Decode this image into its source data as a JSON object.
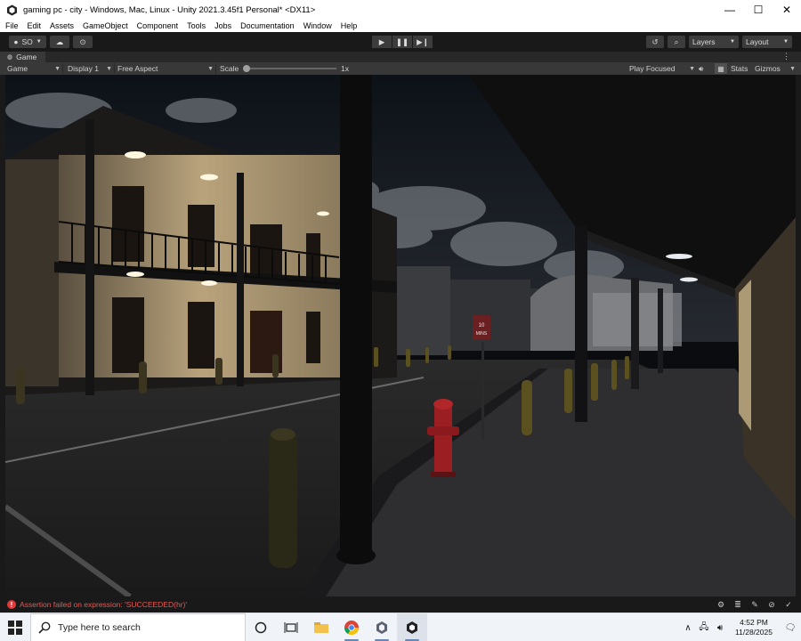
{
  "window": {
    "title": "gaming pc - city - Windows, Mac, Linux - Unity 2021.3.45f1 Personal* <DX11>",
    "controls": [
      "—",
      "☐",
      "✕"
    ]
  },
  "menu": [
    "File",
    "Edit",
    "Assets",
    "GameObject",
    "Component",
    "Tools",
    "Jobs",
    "Documentation",
    "Window",
    "Help"
  ],
  "toolbar": {
    "account_label": "SO",
    "layers_label": "Layers",
    "layout_label": "Layout"
  },
  "game_tab": {
    "label": "Game"
  },
  "game_controls": {
    "mode": "Game",
    "display": "Display 1",
    "aspect": "Free Aspect",
    "scale_label": "Scale",
    "scale_value": "1x",
    "play_mode": "Play Focused",
    "stats_label": "Stats",
    "gizmos_label": "Gizmos"
  },
  "scene": {
    "sign_line1": "10",
    "sign_line2": "MINS"
  },
  "status": {
    "error_message": "Assertion failed on expression: 'SUCCEEDED(hr)'"
  },
  "taskbar": {
    "search_placeholder": "Type here to search",
    "time": "4:52 PM",
    "date": "11/28/2025"
  },
  "colors": {
    "error": "#e35a54",
    "editor_dark": "#191919",
    "panel": "#383838",
    "warm_light": "#e8d4a8"
  }
}
